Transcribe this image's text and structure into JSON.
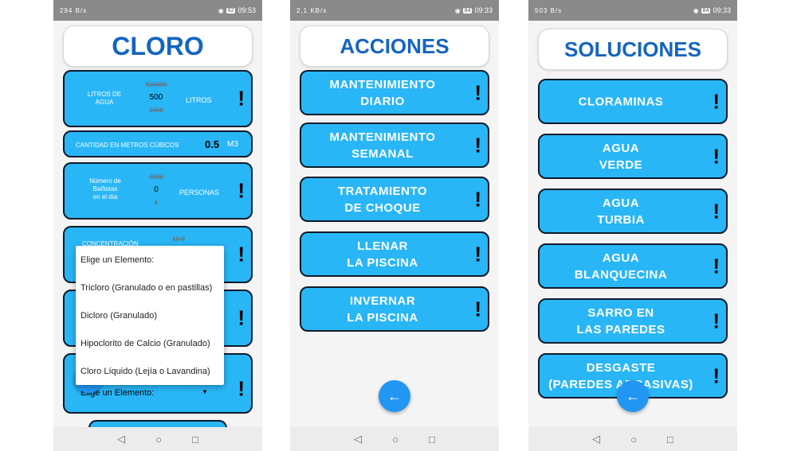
{
  "status_bar": [
    {
      "signal": "294 B/s",
      "battery": "82",
      "time": "09:53"
    },
    {
      "signal": "2,1 KB/s",
      "battery": "84",
      "time": "09:33"
    },
    {
      "signal": "503 B/s",
      "battery": "84",
      "time": "09:33"
    }
  ],
  "screen1": {
    "title": "CLORO",
    "litros": {
      "label_line1": "LITROS DE",
      "label_line2": "AGUA",
      "picker_above": "500000",
      "picker_value": "500",
      "picker_below": "1000",
      "unit": "LITROS"
    },
    "cubicos": {
      "label": "CANTIDAD EN METROS CÚBICOS",
      "value": "0.5",
      "unit": "M3"
    },
    "banistas": {
      "label_line1": "Número de",
      "label_line2": "Bañistas",
      "label_line3": "en el día",
      "picker_above": "2000",
      "picker_value": "0",
      "picker_below": "1",
      "unit": "PERSONAS"
    },
    "concentracion": {
      "label": "CONCENTRACIÓN",
      "picker_above": "10.0"
    },
    "elemento_spinner": "Elige un Elemento:",
    "dropdown": {
      "title": "Elige un Elemento:",
      "options": [
        "Tricloro (Granulado o en pastillas)",
        "Dicloro (Granulado)",
        "Hipoclorito de Calcio (Granulado)",
        "Cloro Líquido (Lejía o Lavandina)"
      ]
    },
    "excl": "!"
  },
  "screen2": {
    "title": "ACCIONES",
    "buttons": [
      {
        "line1": "MANTENIMIENTO",
        "line2": "DIARIO"
      },
      {
        "line1": "MANTENIMIENTO",
        "line2": "SEMANAL"
      },
      {
        "line1": "TRATAMIENTO",
        "line2": "DE CHOQUE"
      },
      {
        "line1": "LLENAR",
        "line2": "LA PISCINA"
      },
      {
        "line1": "INVERNAR",
        "line2": "LA PISCINA"
      }
    ],
    "excl": "!"
  },
  "screen3": {
    "title": "SOLUCIONES",
    "buttons": [
      {
        "line1": "CLORAMINAS",
        "line2": ""
      },
      {
        "line1": "AGUA",
        "line2": "VERDE"
      },
      {
        "line1": "AGUA",
        "line2": "TURBIA"
      },
      {
        "line1": "AGUA",
        "line2": "BLANQUECINA"
      },
      {
        "line1": "SARRO EN",
        "line2": "LAS PAREDES"
      },
      {
        "line1": "DESGASTE",
        "line2": "(PAREDES ABRASIVAS)"
      }
    ],
    "excl": "!"
  },
  "icons": {
    "back_arrow": "←",
    "nav_back": "◁",
    "nav_home": "○",
    "nav_recents": "□"
  },
  "colors": {
    "accent": "#29b6f6",
    "title_blue": "#1565c0",
    "fab_blue": "#2196f3",
    "border": "#0d1b2a"
  }
}
